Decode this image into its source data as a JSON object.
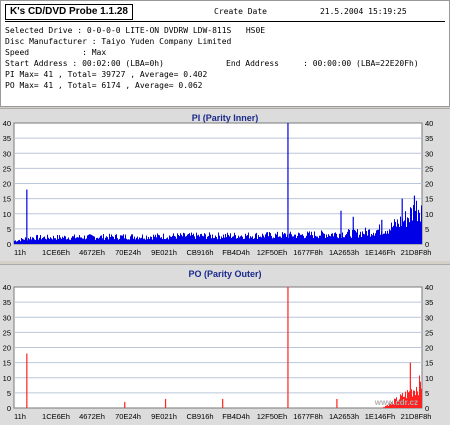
{
  "app": {
    "title": "K's CD/DVD Probe 1.1.28",
    "create_label": "Create Date",
    "create_value": "21.5.2004 15:19:25"
  },
  "info": {
    "line1": "Selected Drive : 0-0-0-0 LITE-ON DVDRW LDW-811S   HS0E",
    "line2": "Disc Manufacturer : Taiyo Yuden Company Limited",
    "line3": "Speed           : Max",
    "line4_start": "Start Address : 00:02:00 (LBA=0h)",
    "line4_end": "End Address     : 00:00:00 (LBA=22E20Fh)",
    "line5": "PI Max= 41 , Total= 39727 , Average= 0.402",
    "line6": "PO Max= 41 , Total= 6174 , Average= 0.062"
  },
  "x_ticks": [
    "11h",
    "1CE6Eh",
    "4672Eh",
    "70E24h",
    "9E021h",
    "CB916h",
    "FB4D4h",
    "12F50Eh",
    "1677F8h",
    "1A2653h",
    "1E146Fh",
    "21D8F8h"
  ],
  "y_ticks": [
    0,
    5,
    10,
    15,
    20,
    25,
    30,
    35,
    40
  ],
  "watermark": "www.cdr.cz",
  "colors": {
    "pi": "#0000e6",
    "po": "#ff2020",
    "grid": "#b9c6d8",
    "title": "#1a2a8c"
  },
  "chart_data": [
    {
      "type": "area",
      "title": "PI (Parity Inner)",
      "ylim": [
        0,
        40
      ],
      "x_categories": [
        "11h",
        "1CE6Eh",
        "4672Eh",
        "70E24h",
        "9E021h",
        "CB916h",
        "FB4D4h",
        "12F50Eh",
        "1677F8h",
        "1A2653h",
        "1E146Fh",
        "21D8F8h"
      ],
      "series": [
        {
          "baseline": [
            [
              0,
              1
            ],
            [
              0.04,
              2
            ],
            [
              0.4,
              2.5
            ],
            [
              0.7,
              2.8
            ],
            [
              0.85,
              3.5
            ],
            [
              0.92,
              5
            ],
            [
              0.96,
              8
            ],
            [
              1,
              13
            ]
          ],
          "spikes": [
            [
              0.03,
              18
            ],
            [
              0.67,
              41
            ],
            [
              0.8,
              11
            ],
            [
              0.83,
              9
            ],
            [
              0.9,
              8
            ],
            [
              0.95,
              15
            ],
            [
              0.98,
              16
            ]
          ]
        }
      ]
    },
    {
      "type": "area",
      "title": "PO (Parity Outer)",
      "ylim": [
        0,
        40
      ],
      "x_categories": [
        "11h",
        "1CE6Eh",
        "4672Eh",
        "70E24h",
        "9E021h",
        "CB916h",
        "FB4D4h",
        "12F50Eh",
        "1677F8h",
        "1A2653h",
        "1E146Fh",
        "21D8F8h"
      ],
      "series": [
        {
          "baseline": [
            [
              0,
              0
            ],
            [
              0.9,
              0
            ],
            [
              0.93,
              2
            ],
            [
              0.97,
              5
            ],
            [
              1,
              8
            ]
          ],
          "spikes": [
            [
              0.03,
              18
            ],
            [
              0.67,
              41
            ],
            [
              0.27,
              2
            ],
            [
              0.37,
              3
            ],
            [
              0.51,
              3
            ],
            [
              0.79,
              3
            ],
            [
              0.97,
              15
            ]
          ]
        }
      ]
    }
  ]
}
